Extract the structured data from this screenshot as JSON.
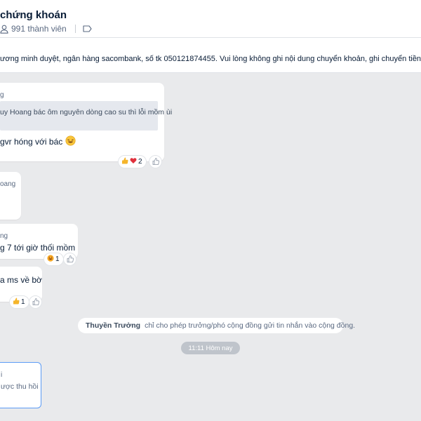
{
  "header": {
    "title": "chứng khoán",
    "member_count": "991 thành viên"
  },
  "pinned": {
    "text": "ương minh duyệt, ngân hàng sacombank, số tk 050121874455. Vui lòng không ghi nội dung chuyển khoản, ghi chuyển tiền hoặc chuyển khoản là đ"
  },
  "messages": [
    {
      "sender": "g",
      "quote": "uy Hoang bác ôm nguyên dòng cao su thì lỗi mồm ùi",
      "text": "gvr hóng với bác",
      "reaction_count": "2"
    },
    {
      "sender": "oang"
    },
    {
      "sender": "ng",
      "text": "g 7 tới giờ thối mồm",
      "reaction_count": "1"
    },
    {
      "text": "a ms về bờ",
      "reaction_count": "1"
    },
    {
      "text_top": "i",
      "text_bottom": "ược thu hồi"
    }
  ],
  "system": {
    "name": "Thuyền Trưởng",
    "text": "chỉ cho phép trưởng/phó cộng đồng gửi tin nhắn vào cộng đồng."
  },
  "time_chip": "11:11 Hôm nay",
  "colors": {
    "background": "#e9eaec",
    "bubble": "#ffffff",
    "accent_border": "#5b9bf5",
    "heart": "#e0303c",
    "thumb": "#f5b52a"
  },
  "icons": [
    "member-icon",
    "tag-icon",
    "thumbs-up-icon",
    "heart-icon",
    "like-outline-icon",
    "laughing-face-icon",
    "grinning-face-icon"
  ]
}
